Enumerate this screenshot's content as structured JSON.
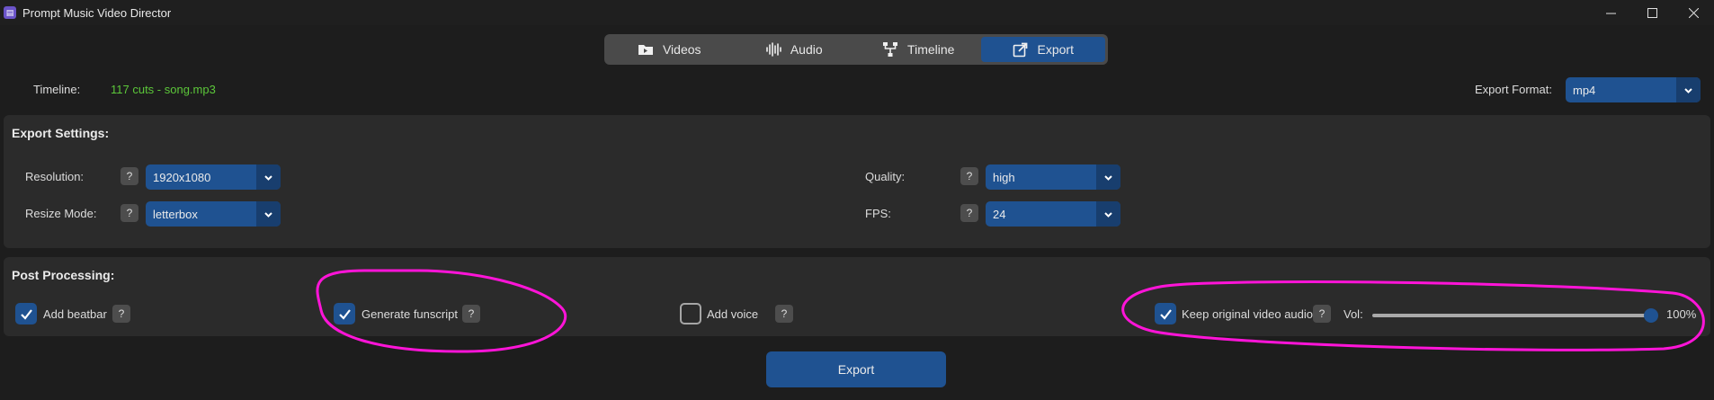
{
  "window": {
    "title": "Prompt Music Video Director",
    "icon": "app-icon",
    "controls": [
      "minimize-icon",
      "maximize-icon",
      "close-icon"
    ]
  },
  "tabs": [
    {
      "label": "Videos",
      "icon": "video-folder-icon",
      "active": false
    },
    {
      "label": "Audio",
      "icon": "waveform-icon",
      "active": false
    },
    {
      "label": "Timeline",
      "icon": "timeline-branch-icon",
      "active": false
    },
    {
      "label": "Export",
      "icon": "export-share-icon",
      "active": true
    }
  ],
  "timeline": {
    "label": "Timeline:",
    "value": "117 cuts - song.mp3"
  },
  "export_format": {
    "label": "Export Format:",
    "value": "mp4"
  },
  "export_settings": {
    "title": "Export Settings:",
    "resolution": {
      "label": "Resolution:",
      "value": "1920x1080"
    },
    "resize_mode": {
      "label": "Resize Mode:",
      "value": "letterbox"
    },
    "quality": {
      "label": "Quality:",
      "value": "high"
    },
    "fps": {
      "label": "FPS:",
      "value": "24"
    }
  },
  "help_label": "?",
  "post_processing": {
    "title": "Post Processing:",
    "add_beatbar": {
      "label": "Add beatbar",
      "checked": true
    },
    "generate_funscript": {
      "label": "Generate funscript",
      "checked": true
    },
    "add_voice": {
      "label": "Add voice",
      "checked": false
    },
    "keep_original_audio": {
      "label": "Keep original video audio",
      "checked": true
    },
    "volume": {
      "label": "Vol:",
      "value_text": "100%",
      "value": 1.0
    }
  },
  "export_button": "Export",
  "colors": {
    "accent": "#1f5291",
    "timeline_value": "#5cc73a",
    "annotation": "#ff14d8"
  }
}
